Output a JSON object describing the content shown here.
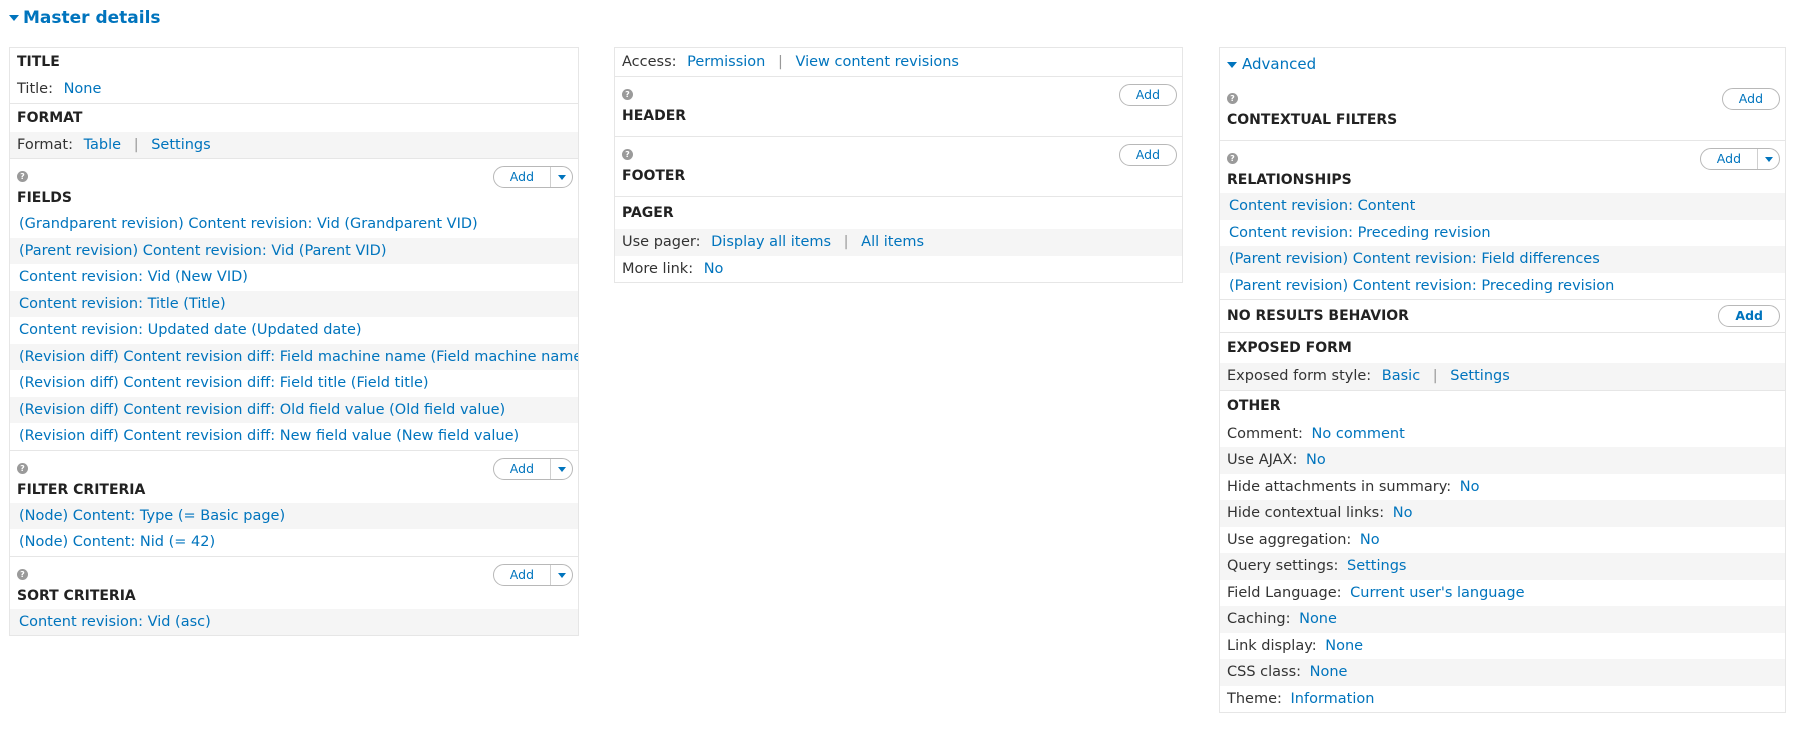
{
  "master": {
    "title": "Master details"
  },
  "col1": {
    "title": {
      "heading": "TITLE",
      "label": "Title:",
      "value": "None"
    },
    "format": {
      "heading": "FORMAT",
      "label": "Format:",
      "value": "Table",
      "settings": "Settings"
    },
    "fields": {
      "heading": "FIELDS",
      "add": "Add",
      "items": [
        "(Grandparent revision) Content revision: Vid (Grandparent VID)",
        "(Parent revision) Content revision: Vid (Parent VID)",
        "Content revision: Vid (New VID)",
        "Content revision: Title (Title)",
        "Content revision: Updated date (Updated date)",
        "(Revision diff) Content revision diff: Field machine name (Field machine name)",
        "(Revision diff) Content revision diff: Field title (Field title)",
        "(Revision diff) Content revision diff: Old field value (Old field value)",
        "(Revision diff) Content revision diff: New field value (New field value)"
      ]
    },
    "filters": {
      "heading": "FILTER CRITERIA",
      "add": "Add",
      "items": [
        "(Node) Content: Type (= Basic page)",
        "(Node) Content: Nid (= 42)"
      ]
    },
    "sorts": {
      "heading": "SORT CRITERIA",
      "add": "Add",
      "items": [
        "Content revision: Vid (asc)"
      ]
    }
  },
  "col2": {
    "access": {
      "label": "Access:",
      "value": "Permission",
      "value2": "View content revisions"
    },
    "header": {
      "heading": "HEADER",
      "add": "Add"
    },
    "footer": {
      "heading": "FOOTER",
      "add": "Add"
    },
    "pager": {
      "heading": "PAGER",
      "use_label": "Use pager:",
      "use_value": "Display all items",
      "use_value2": "All items",
      "more_label": "More link:",
      "more_value": "No"
    }
  },
  "col3": {
    "advanced": {
      "label": "Advanced"
    },
    "contextual": {
      "heading": "CONTEXTUAL FILTERS",
      "add": "Add"
    },
    "relationships": {
      "heading": "RELATIONSHIPS",
      "add": "Add",
      "items": [
        "Content revision: Content",
        "Content revision: Preceding revision",
        "(Parent revision) Content revision: Field differences",
        "(Parent revision) Content revision: Preceding revision"
      ]
    },
    "no_results": {
      "heading": "NO RESULTS BEHAVIOR",
      "add": "Add"
    },
    "exposed": {
      "heading": "EXPOSED FORM",
      "label": "Exposed form style:",
      "value": "Basic",
      "settings": "Settings"
    },
    "other": {
      "heading": "OTHER",
      "rows": [
        {
          "label": "Comment:",
          "value": "No comment"
        },
        {
          "label": "Use AJAX:",
          "value": "No"
        },
        {
          "label": "Hide attachments in summary:",
          "value": "No"
        },
        {
          "label": "Hide contextual links:",
          "value": "No"
        },
        {
          "label": "Use aggregation:",
          "value": "No"
        },
        {
          "label": "Query settings:",
          "value": "Settings"
        },
        {
          "label": "Field Language:",
          "value": "Current user's language"
        },
        {
          "label": "Caching:",
          "value": "None"
        },
        {
          "label": "Link display:",
          "value": "None"
        },
        {
          "label": "CSS class:",
          "value": "None"
        },
        {
          "label": "Theme:",
          "value": "Information"
        }
      ]
    }
  },
  "help_glyph": "?"
}
